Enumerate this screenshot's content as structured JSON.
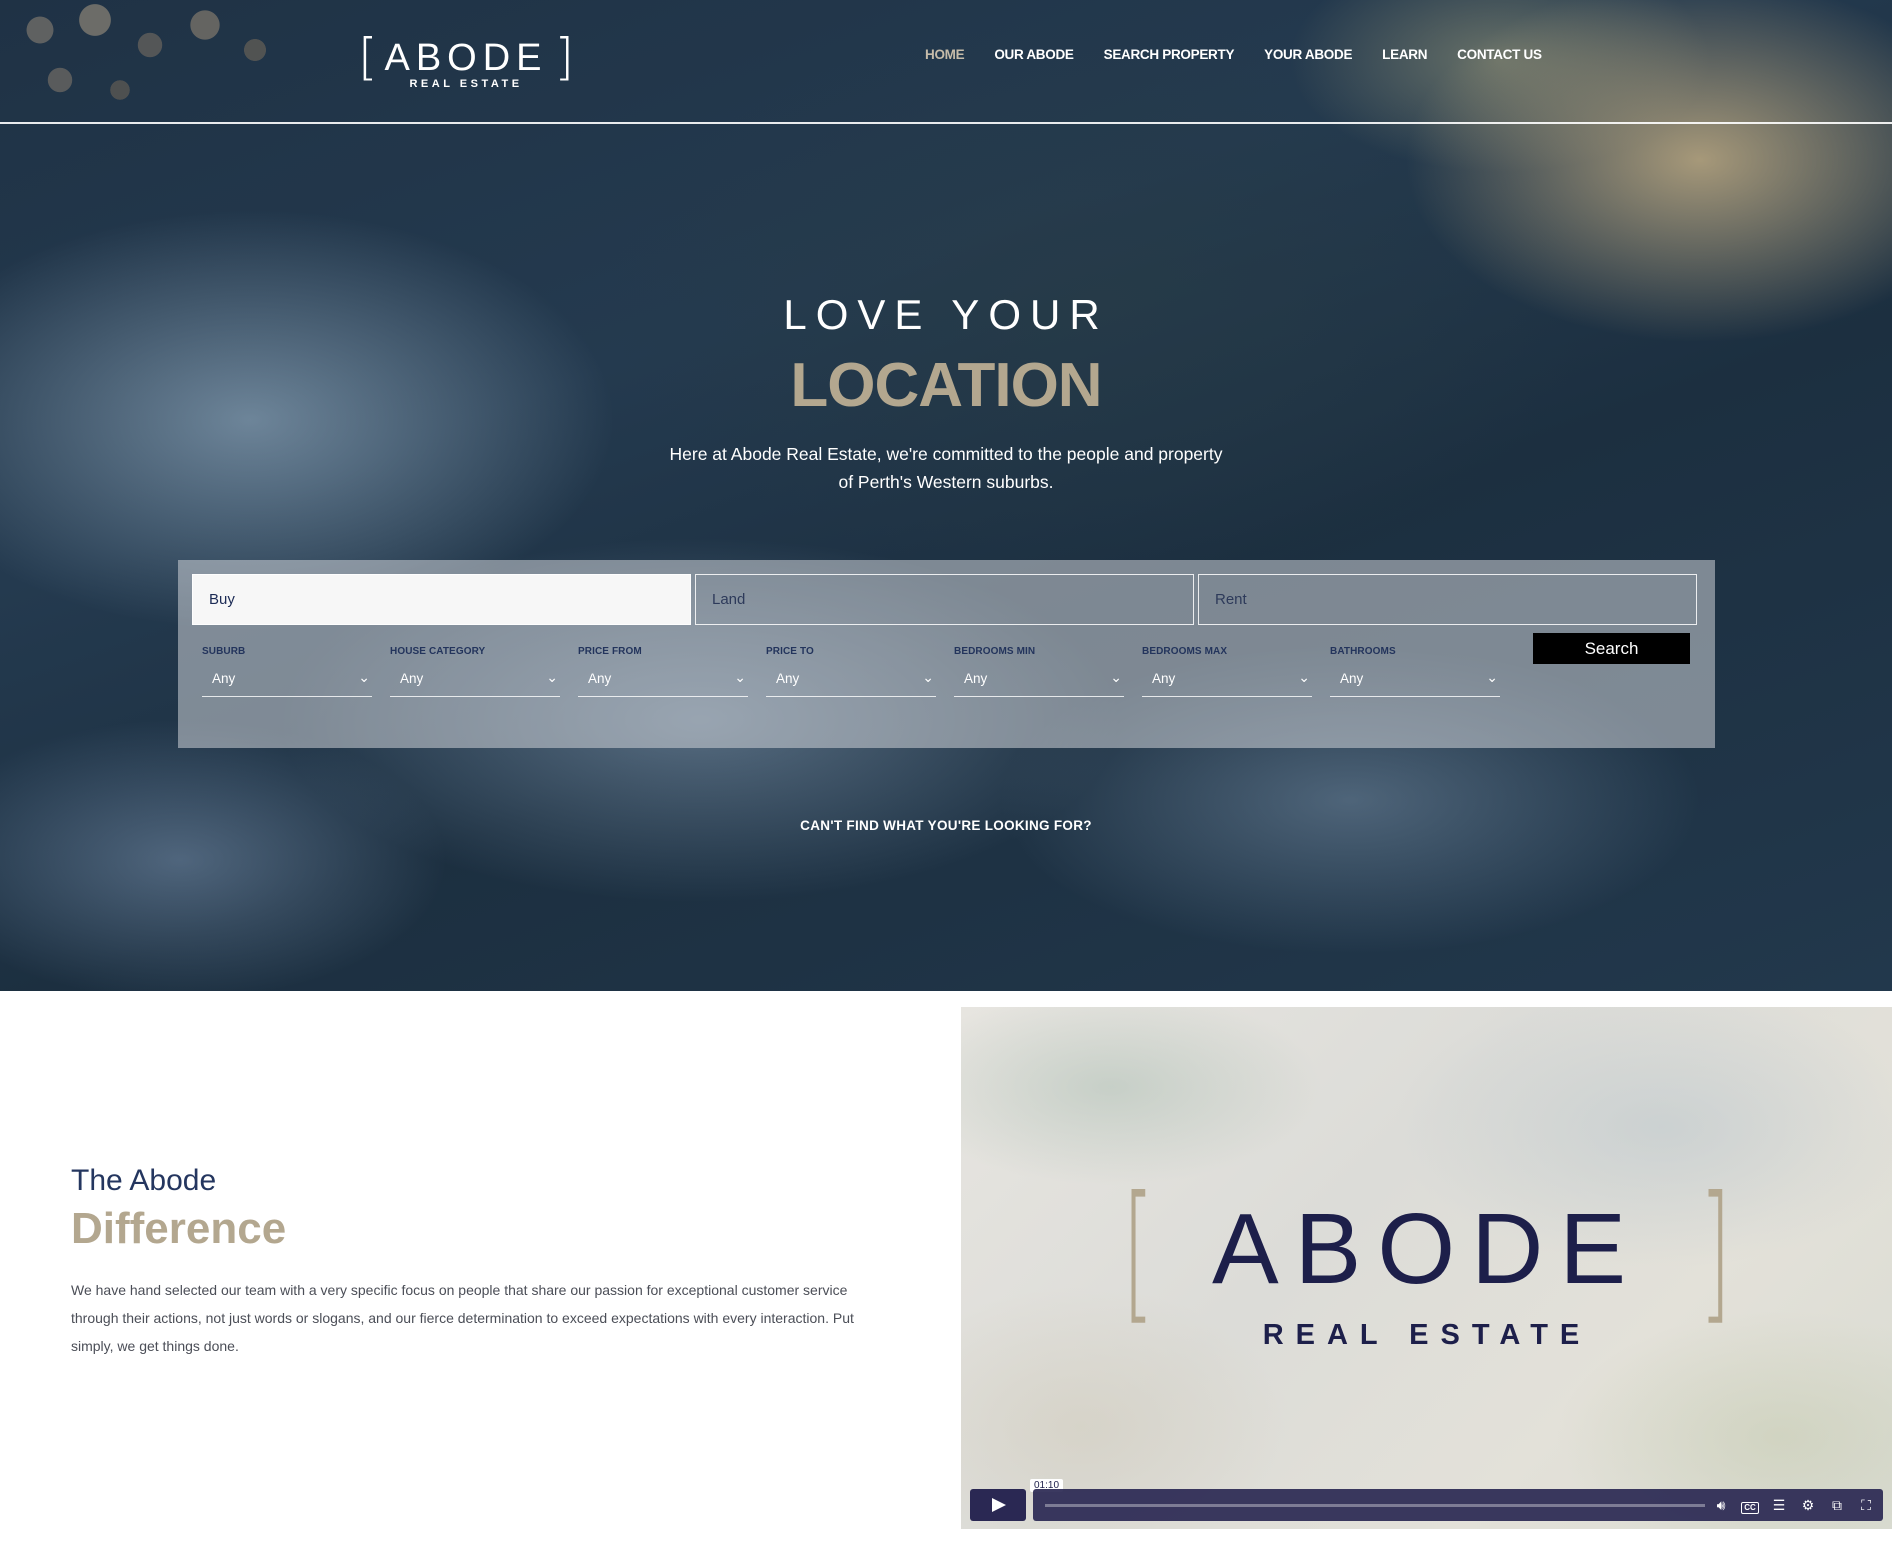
{
  "header": {
    "logo": {
      "word": "ABODE",
      "sub": "REAL ESTATE",
      "bracket_left": "[",
      "bracket_right": "]"
    },
    "nav": [
      {
        "label": "HOME",
        "active": true
      },
      {
        "label": "OUR ABODE"
      },
      {
        "label": "SEARCH PROPERTY"
      },
      {
        "label": "YOUR ABODE"
      },
      {
        "label": "LEARN"
      },
      {
        "label": "CONTACT US"
      }
    ]
  },
  "hero": {
    "line1": "LOVE YOUR",
    "line2": "LOCATION",
    "description": "Here at Abode Real Estate, we're committed to the people and property of Perth's Western suburbs."
  },
  "search": {
    "tabs": [
      {
        "label": "Buy",
        "active": true
      },
      {
        "label": "Land"
      },
      {
        "label": "Rent"
      }
    ],
    "button_label": "Search",
    "fields": [
      {
        "label": "SUBURB",
        "value": "Any"
      },
      {
        "label": "HOUSE CATEGORY",
        "value": "Any"
      },
      {
        "label": "PRICE FROM",
        "value": "Any"
      },
      {
        "label": "PRICE TO",
        "value": "Any"
      },
      {
        "label": "BEDROOMS MIN",
        "value": "Any"
      },
      {
        "label": "BEDROOMS MAX",
        "value": "Any"
      },
      {
        "label": "BATHROOMS",
        "value": "Any"
      }
    ],
    "cant_find": "CAN'T FIND WHAT YOU'RE LOOKING FOR?"
  },
  "difference": {
    "title1": "The Abode",
    "title2": "Difference",
    "body": "We have hand selected our team with a very specific focus on people that share our passion for exceptional customer service through their actions, not just words or slogans, and our fierce determination to exceed expectations with every interaction. Put simply, we get things done."
  },
  "video": {
    "logo_word": "ABODE",
    "logo_sub": "REAL ESTATE",
    "bracket_left": "[",
    "bracket_right": "]",
    "duration": "01:10",
    "progress": 0,
    "icons": [
      "volume-icon",
      "captions-icon",
      "transcript-icon",
      "settings-icon",
      "picture-in-picture-icon",
      "fullscreen-icon"
    ]
  },
  "colors": {
    "accent_taupe": "#b3a78f",
    "navy": "#24365f",
    "nav_active": "#c6bcaa",
    "player": "#2a2853"
  }
}
